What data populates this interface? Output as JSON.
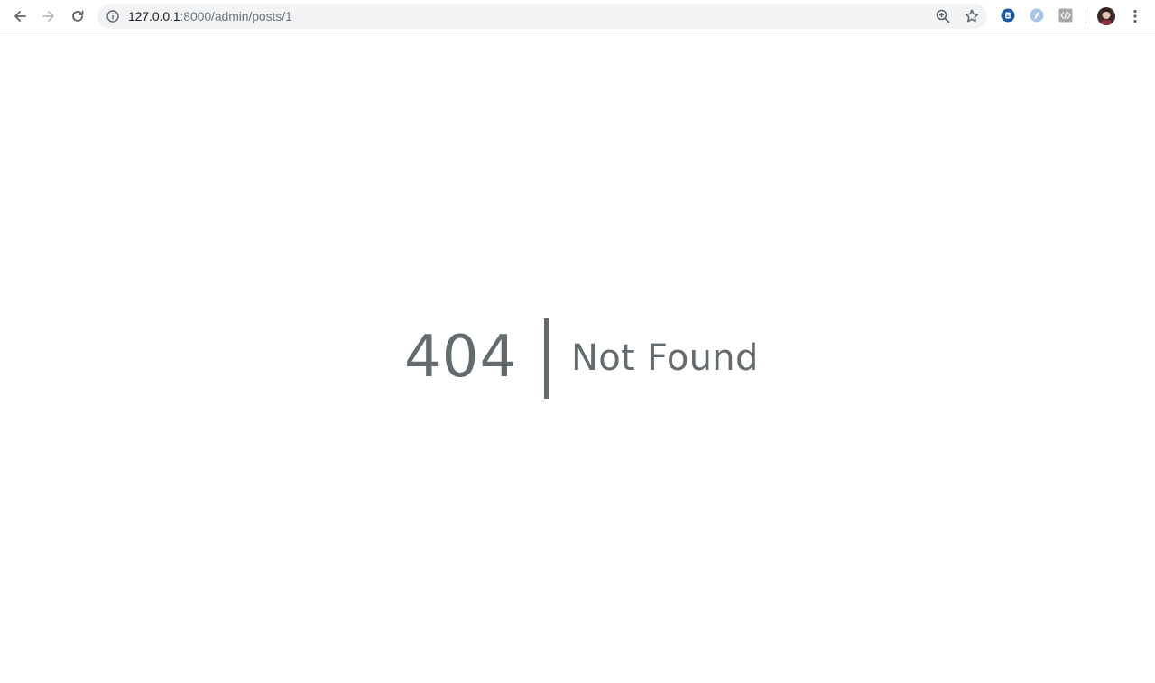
{
  "browser": {
    "url_host": "127.0.0.1",
    "url_rest": ":8000/admin/posts/1",
    "icons": {
      "back": "back-arrow-icon",
      "forward": "forward-arrow-icon",
      "reload": "reload-icon",
      "site_info": "info-icon",
      "zoom": "zoom-icon",
      "bookmark": "star-icon",
      "ext1": "extension-icon",
      "ext2": "extension-icon",
      "ext3": "code-extension-icon",
      "menu": "kebab-menu-icon"
    }
  },
  "error": {
    "code": "404",
    "message": "Not Found"
  },
  "colors": {
    "text": "#636b6f",
    "omnibox_bg": "#f1f3f4",
    "ext_blue": "#1a5a9e"
  }
}
